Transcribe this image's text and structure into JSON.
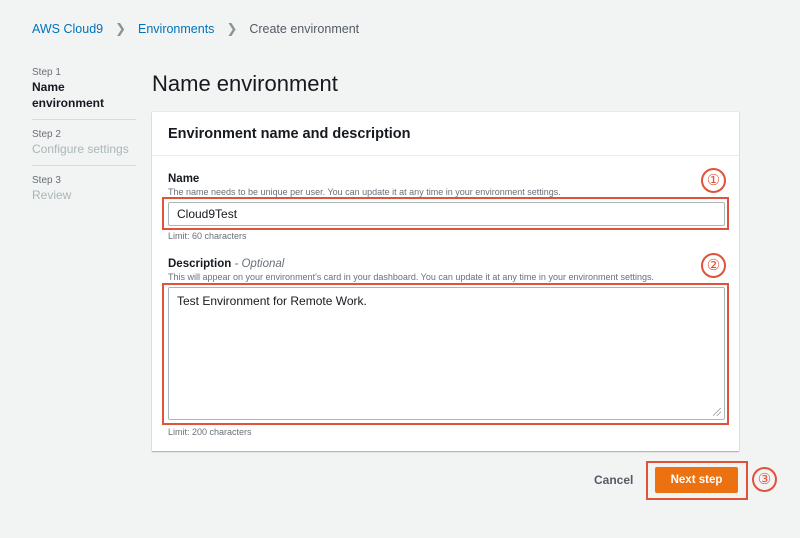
{
  "breadcrumb": {
    "root": "AWS Cloud9",
    "parent": "Environments",
    "current": "Create environment"
  },
  "steps": [
    {
      "num": "Step 1",
      "title": "Name environment",
      "state": "active"
    },
    {
      "num": "Step 2",
      "title": "Configure settings",
      "state": "inactive"
    },
    {
      "num": "Step 3",
      "title": "Review",
      "state": "inactive"
    }
  ],
  "page": {
    "title": "Name environment"
  },
  "panel": {
    "header": "Environment name and description",
    "name": {
      "label": "Name",
      "description": "The name needs to be unique per user. You can update it at any time in your environment settings.",
      "value": "Cloud9Test",
      "limit": "Limit: 60 characters"
    },
    "description": {
      "label": "Description",
      "optional": " - Optional",
      "description": "This will appear on your environment's card in your dashboard. You can update it at any time in your environment settings.",
      "value": "Test Environment for Remote Work.",
      "limit": "Limit: 200 characters"
    }
  },
  "annotations": {
    "one": "①",
    "two": "②",
    "three": "③",
    "color": "#e0533a"
  },
  "actions": {
    "cancel": "Cancel",
    "next": "Next step"
  },
  "colors": {
    "primary": "#ec7211",
    "link": "#0073bb",
    "background": "#f2f3f3"
  }
}
